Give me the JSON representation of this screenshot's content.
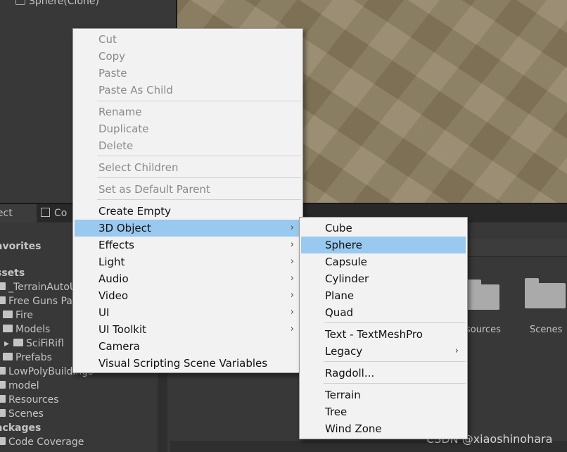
{
  "hierarchy": {
    "item_label": "Sphere(Clone)"
  },
  "tabs": {
    "project": "ject",
    "console": "Co"
  },
  "project_tree": [
    {
      "label": "avorites",
      "bold": true
    },
    {
      "label": "ssets",
      "bold": true
    },
    {
      "label": "_TerrainAutoU",
      "bold": false
    },
    {
      "label": "Free Guns Pa",
      "bold": false
    },
    {
      "label": "Fire",
      "bold": false
    },
    {
      "label": "Models",
      "bold": false
    },
    {
      "label": "SciFiRifl",
      "bold": false
    },
    {
      "label": "Prefabs",
      "bold": false
    },
    {
      "label": "LowPolyBuildings",
      "bold": false
    },
    {
      "label": "model",
      "bold": false
    },
    {
      "label": "Resources",
      "bold": false
    },
    {
      "label": "Scenes",
      "bold": false
    },
    {
      "label": "ackages",
      "bold": true
    },
    {
      "label": "Code Coverage",
      "bold": false
    }
  ],
  "asset_folders": [
    {
      "label": "sources"
    },
    {
      "label": "Scenes"
    }
  ],
  "context_menu": {
    "items": [
      {
        "label": "Cut",
        "disabled": true
      },
      {
        "label": "Copy",
        "disabled": true
      },
      {
        "label": "Paste",
        "disabled": true
      },
      {
        "label": "Paste As Child",
        "disabled": true
      },
      {
        "label": "Rename",
        "disabled": true
      },
      {
        "label": "Duplicate",
        "disabled": true
      },
      {
        "label": "Delete",
        "disabled": true
      },
      {
        "label": "Select Children",
        "disabled": true
      },
      {
        "label": "Set as Default Parent",
        "disabled": true
      },
      {
        "label": "Create Empty",
        "disabled": false
      },
      {
        "label": "3D Object",
        "disabled": false,
        "submenu": true,
        "selected": true
      },
      {
        "label": "Effects",
        "disabled": false,
        "submenu": true
      },
      {
        "label": "Light",
        "disabled": false,
        "submenu": true
      },
      {
        "label": "Audio",
        "disabled": false,
        "submenu": true
      },
      {
        "label": "Video",
        "disabled": false,
        "submenu": true
      },
      {
        "label": "UI",
        "disabled": false,
        "submenu": true
      },
      {
        "label": "UI Toolkit",
        "disabled": false,
        "submenu": true
      },
      {
        "label": "Camera",
        "disabled": false
      },
      {
        "label": "Visual Scripting Scene Variables",
        "disabled": false
      }
    ]
  },
  "submenu_3d_object": {
    "items": [
      {
        "label": "Cube"
      },
      {
        "label": "Sphere",
        "selected": true
      },
      {
        "label": "Capsule"
      },
      {
        "label": "Cylinder"
      },
      {
        "label": "Plane"
      },
      {
        "label": "Quad"
      },
      {
        "label": "Text - TextMeshPro"
      },
      {
        "label": "Legacy",
        "submenu": true
      },
      {
        "label": "Ragdoll..."
      },
      {
        "label": "Terrain"
      },
      {
        "label": "Tree"
      },
      {
        "label": "Wind Zone"
      }
    ]
  },
  "submenu_arrow_glyph": "›",
  "watermark": "CSDN @xiaoshinohara",
  "colors": {
    "menu_bg": "#f2f2f2",
    "highlight": "#99c9ef",
    "editor_bg": "#383838"
  }
}
